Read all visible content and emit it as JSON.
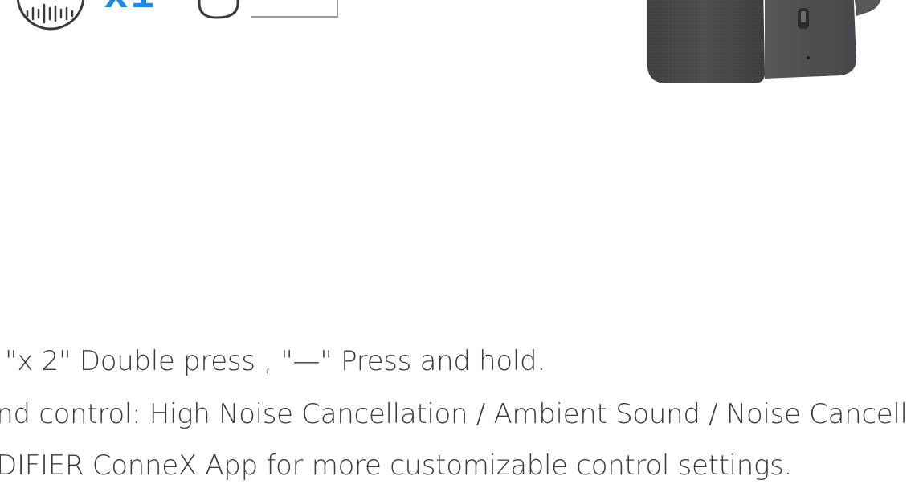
{
  "gestures": {
    "sound_icon": "sound-wave-circle-icon",
    "press_count": "x1",
    "tap_icon": "finger-tap-icon",
    "hold_icon": "press-hold-bar-icon",
    "accent_color": "#1E88E5"
  },
  "product_image": {
    "icon": "headphone-earcup-image",
    "body_color": "#4a4b4d",
    "port_color": "#2b2c2e"
  },
  "notes": {
    "line1": "\"x 2\" Double press , \"—\" Press and hold.",
    "line2": "und control: High Noise Cancellation / Ambient Sound / Noise Cancell",
    "line3": "EDIFIER ConneX App for more customizable control settings."
  }
}
